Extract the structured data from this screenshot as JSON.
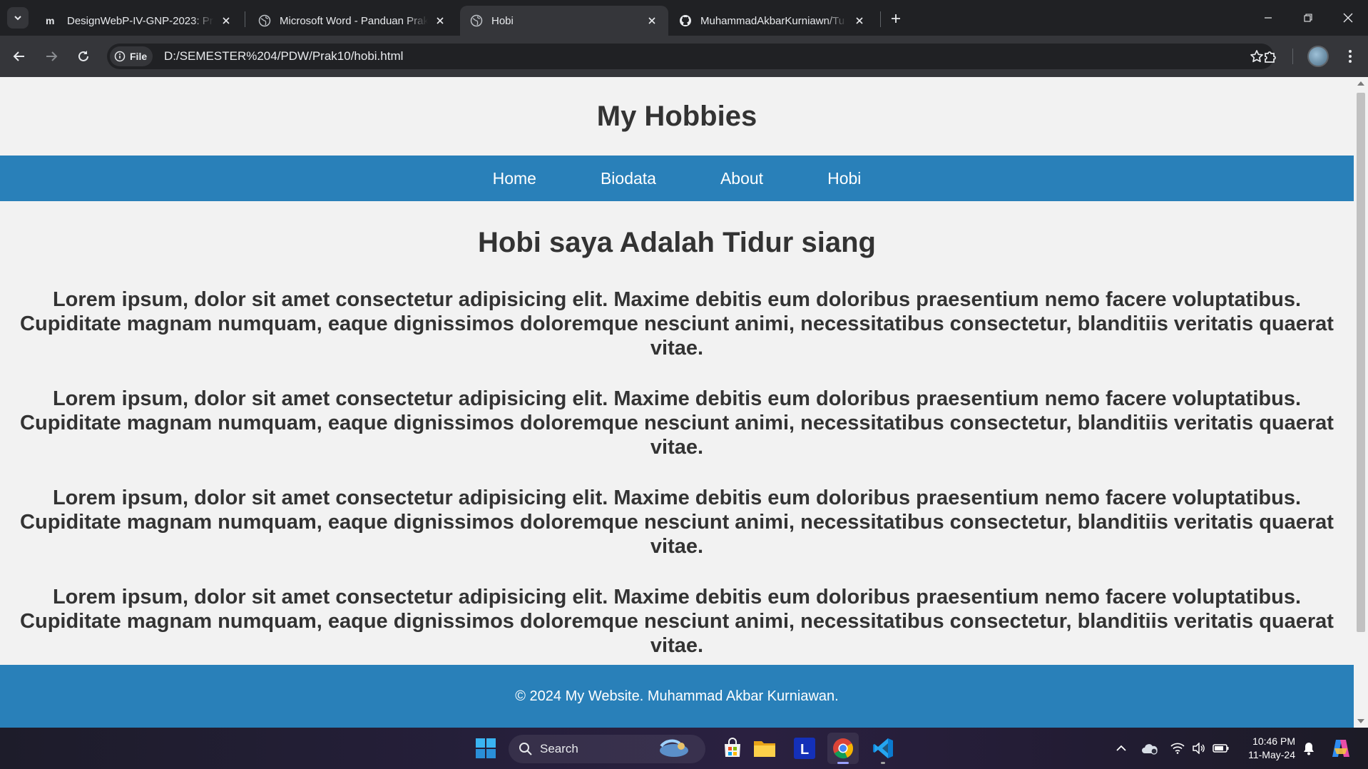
{
  "browser": {
    "tabs": [
      {
        "title": "DesignWebP-IV-GNP-2023: Pra",
        "icon": "moodle-icon",
        "active": false
      },
      {
        "title": "Microsoft Word - Panduan Prak",
        "icon": "globe-icon",
        "active": false
      },
      {
        "title": "Hobi",
        "icon": "globe-icon",
        "active": true
      },
      {
        "title": "MuhammadAkbarKurniawn/Tu",
        "icon": "github-icon",
        "active": false
      }
    ],
    "address": {
      "chip_label": "File",
      "url": "D:/SEMESTER%204/PDW/Prak10/hobi.html"
    }
  },
  "page": {
    "header_title": "My Hobbies",
    "nav": [
      "Home",
      "Biodata",
      "About",
      "Hobi"
    ],
    "heading": "Hobi saya Adalah Tidur siang",
    "paragraphs": [
      "Lorem ipsum, dolor sit amet consectetur adipisicing elit. Maxime debitis eum doloribus praesentium nemo facere voluptatibus. Cupiditate magnam numquam, eaque dignissimos doloremque nesciunt animi, necessitatibus consectetur, blanditiis veritatis quaerat vitae.",
      "Lorem ipsum, dolor sit amet consectetur adipisicing elit. Maxime debitis eum doloribus praesentium nemo facere voluptatibus. Cupiditate magnam numquam, eaque dignissimos doloremque nesciunt animi, necessitatibus consectetur, blanditiis veritatis quaerat vitae.",
      "Lorem ipsum, dolor sit amet consectetur adipisicing elit. Maxime debitis eum doloribus praesentium nemo facere voluptatibus. Cupiditate magnam numquam, eaque dignissimos doloremque nesciunt animi, necessitatibus consectetur, blanditiis veritatis quaerat vitae.",
      "Lorem ipsum, dolor sit amet consectetur adipisicing elit. Maxime debitis eum doloribus praesentium nemo facere voluptatibus. Cupiditate magnam numquam, eaque dignissimos doloremque nesciunt animi, necessitatibus consectetur, blanditiis veritatis quaerat vitae."
    ],
    "footer": "© 2024 My Website. Muhammad Akbar Kurniawan.",
    "colors": {
      "accent": "#2980b9",
      "background": "#f2f2f2",
      "text": "#333333"
    }
  },
  "taskbar": {
    "search_label": "Search",
    "apps": [
      "windows-start-icon",
      "search-icon",
      "microsoft-store-icon",
      "file-explorer-icon",
      "l-app-icon",
      "chrome-icon",
      "vscode-icon"
    ],
    "tray_icons": [
      "chevron-up-icon",
      "onedrive-icon",
      "wifi-icon",
      "volume-icon",
      "battery-icon",
      "notification-bell-icon",
      "copilot-icon"
    ],
    "time": "10:46 PM",
    "date": "11-May-24"
  }
}
